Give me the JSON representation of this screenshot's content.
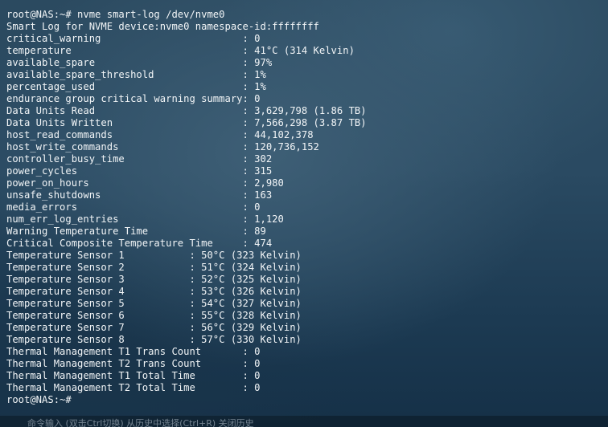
{
  "terminal": {
    "lines": [
      "root@NAS:~# nvme smart-log /dev/nvme0",
      "Smart Log for NVME device:nvme0 namespace-id:ffffffff",
      "critical_warning                        : 0",
      "temperature                             : 41°C (314 Kelvin)",
      "available_spare                         : 97%",
      "available_spare_threshold               : 1%",
      "percentage_used                         : 1%",
      "endurance group critical warning summary: 0",
      "Data Units Read                         : 3,629,798 (1.86 TB)",
      "Data Units Written                      : 7,566,298 (3.87 TB)",
      "host_read_commands                      : 44,102,378",
      "host_write_commands                     : 120,736,152",
      "controller_busy_time                    : 302",
      "power_cycles                            : 315",
      "power_on_hours                          : 2,980",
      "unsafe_shutdowns                        : 163",
      "media_errors                            : 0",
      "num_err_log_entries                     : 1,120",
      "Warning Temperature Time                : 89",
      "Critical Composite Temperature Time     : 474",
      "Temperature Sensor 1           : 50°C (323 Kelvin)",
      "Temperature Sensor 2           : 51°C (324 Kelvin)",
      "Temperature Sensor 3           : 52°C (325 Kelvin)",
      "Temperature Sensor 4           : 53°C (326 Kelvin)",
      "Temperature Sensor 5           : 54°C (327 Kelvin)",
      "Temperature Sensor 6           : 55°C (328 Kelvin)",
      "Temperature Sensor 7           : 56°C (329 Kelvin)",
      "Temperature Sensor 8           : 57°C (330 Kelvin)",
      "Thermal Management T1 Trans Count       : 0",
      "Thermal Management T2 Trans Count       : 0",
      "Thermal Management T1 Total Time        : 0",
      "Thermal Management T2 Total Time        : 0",
      "root@NAS:~#"
    ]
  },
  "bottom_bar": {
    "text": "命令输入 (双击Ctrl切换) 从历史中选择(Ctrl+R) 关闭历史"
  }
}
